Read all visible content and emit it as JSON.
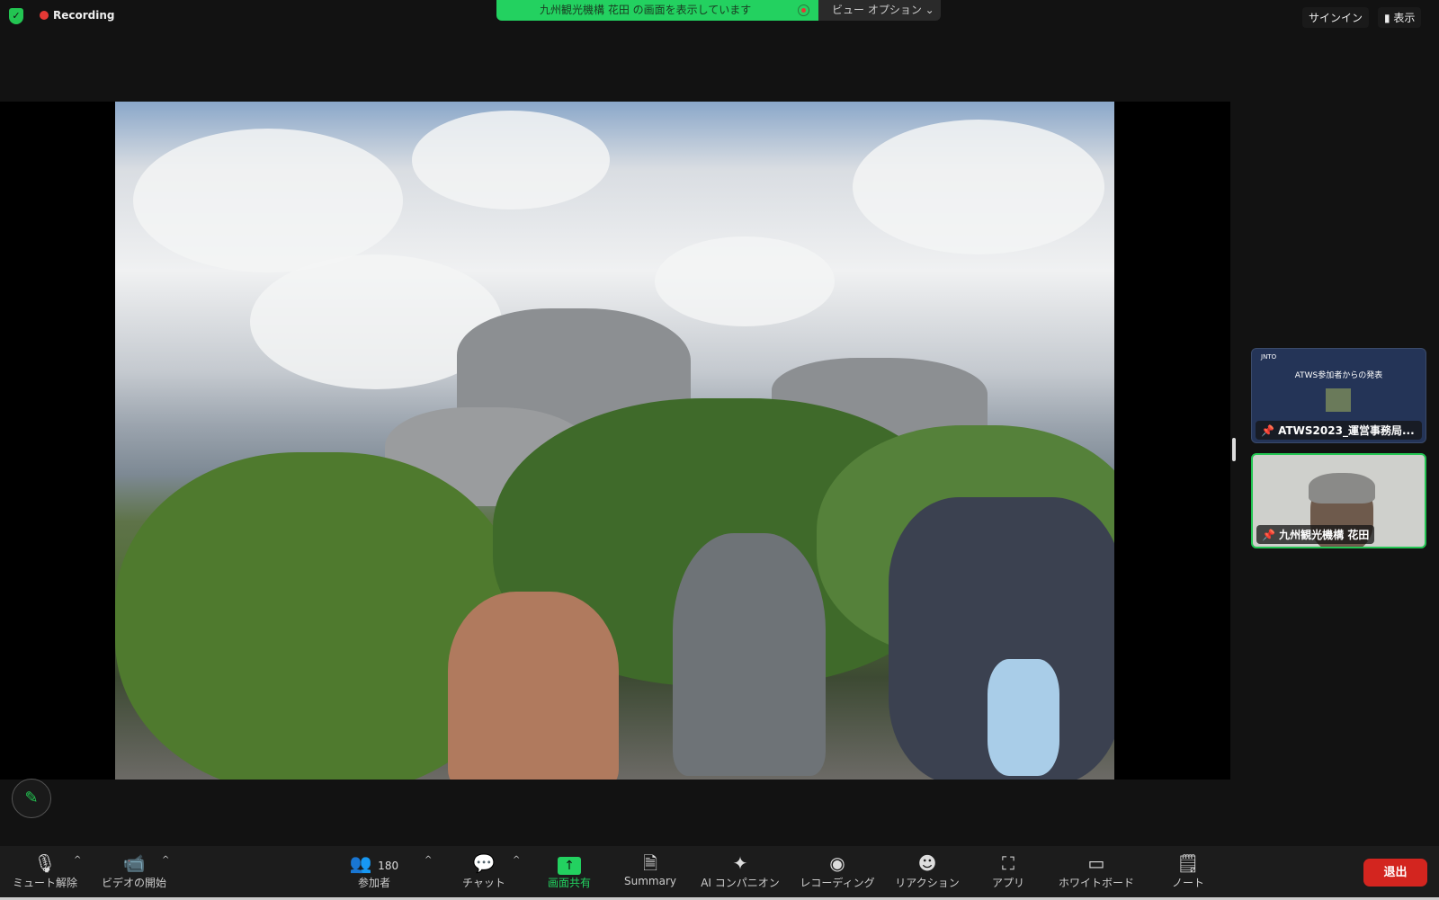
{
  "topbar": {
    "recording": "Recording",
    "share_banner": "九州観光機構 花田 の画面を表示しています",
    "view_options": "ビュー オプション ⌄",
    "sign_in": "サインイン",
    "view": "表示"
  },
  "thumbnails": [
    {
      "slide_logo": "JNTO",
      "slide_title": "ATWS参加者からの発表",
      "label": "ATWS2023_運営事務局..."
    },
    {
      "label": "九州観光機構 花田"
    }
  ],
  "toolbar": {
    "mute": "ミュート解除",
    "video": "ビデオの開始",
    "participants": "参加者",
    "participant_count": "180",
    "chat": "チャット",
    "share": "画面共有",
    "summary": "Summary",
    "ai": "AI コンパニオン",
    "record": "レコーディング",
    "reactions": "リアクション",
    "apps": "アプリ",
    "whiteboard": "ホワイトボード",
    "notes": "ノート",
    "leave": "退出"
  },
  "colors": {
    "accent": "#23d160",
    "leave": "#d3251f"
  }
}
